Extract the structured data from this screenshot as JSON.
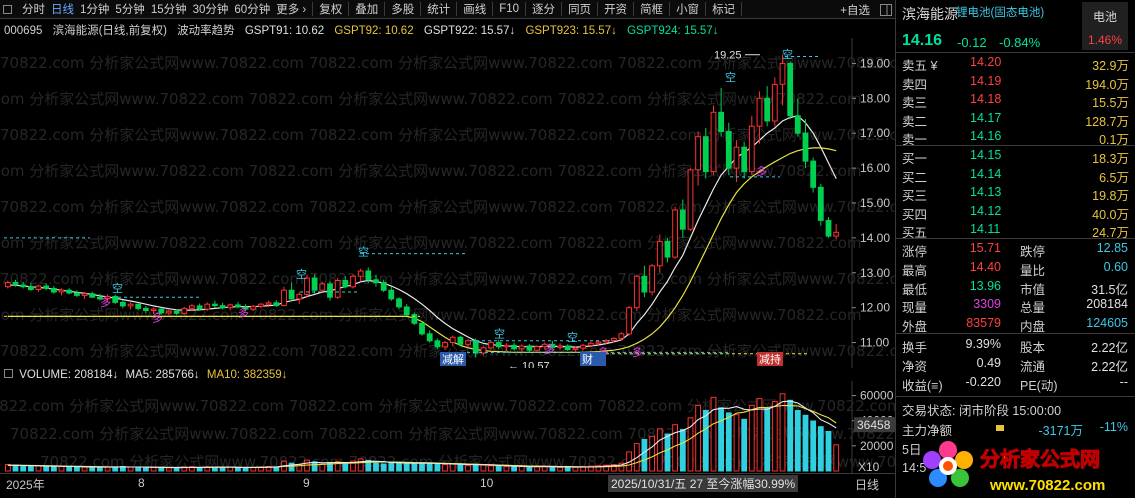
{
  "toolbar": {
    "items": [
      "分时",
      "日线",
      "1分钟",
      "5分钟",
      "15分钟",
      "30分钟",
      "60分钟",
      "更多 ›",
      "复权",
      "叠加",
      "多股",
      "统计",
      "画线",
      "F10",
      "逐分",
      "同页",
      "开资",
      "简框",
      "小窗",
      "标记"
    ],
    "add_label": "+自选",
    "active_index": 1
  },
  "indicator": {
    "code": "000695",
    "name": "滨海能源(日线,前复权)",
    "label": "波动率趋势",
    "g91": "GSPT91: 10.62",
    "g92": "GSPT92: 10.62",
    "g922": "GSPT922: 15.57↓",
    "g923": "GSPT923: 15.57↓",
    "g924": "GSPT924: 15.57↓"
  },
  "colors": {
    "up": "#ff3030",
    "down": "#00d050",
    "ma_white": "#e8e8e8",
    "ma_yellow": "#e8e040",
    "cyan": "#3cc8e6",
    "grid": "#262626"
  },
  "watermark": "70822.com 分析家公式网www.70822.com",
  "price_axis": {
    "ticks": [
      "19.00",
      "18.00",
      "17.00",
      "16.00",
      "15.00",
      "14.00",
      "13.00",
      "12.00",
      "11.00"
    ],
    "values": [
      19,
      18,
      17,
      16,
      15,
      14,
      13,
      12,
      11
    ],
    "min": 10.5,
    "max": 19.5
  },
  "annotations": {
    "high": "19.25",
    "low": "10.57",
    "kong": "空",
    "duo": "多",
    "jiebei": "减解",
    "cai": "财",
    "guaxia": "减持"
  },
  "volume": {
    "header_label": "VOLUME: 208184↓",
    "ma5_label": "MA5: 285766↓",
    "ma10_label": "MA10: 382359↓",
    "axis_ticks": [
      "60000",
      "40000",
      "20000"
    ],
    "axis_values": [
      60000,
      40000,
      20000
    ],
    "current_tag": "36458",
    "unit": "X10",
    "max": 70000
  },
  "date_axis": {
    "labels": [
      "2025年",
      "8",
      "9",
      "10",
      "日线"
    ],
    "status": "2025/10/31/五 27 至今涨幅30.99%"
  },
  "chart_data": {
    "type": "candlestick",
    "ohlc": [
      [
        12.6,
        12.78,
        12.55,
        12.72
      ],
      [
        12.72,
        12.8,
        12.6,
        12.65
      ],
      [
        12.65,
        12.74,
        12.55,
        12.6
      ],
      [
        12.6,
        12.7,
        12.48,
        12.52
      ],
      [
        12.52,
        12.66,
        12.45,
        12.62
      ],
      [
        12.62,
        12.7,
        12.5,
        12.55
      ],
      [
        12.55,
        12.62,
        12.4,
        12.45
      ],
      [
        12.45,
        12.55,
        12.35,
        12.5
      ],
      [
        12.5,
        12.56,
        12.38,
        12.42
      ],
      [
        12.42,
        12.5,
        12.3,
        12.35
      ],
      [
        12.35,
        12.45,
        12.25,
        12.4
      ],
      [
        12.4,
        12.46,
        12.28,
        12.3
      ],
      [
        12.3,
        12.4,
        12.2,
        12.25
      ],
      [
        12.25,
        12.38,
        12.15,
        12.32
      ],
      [
        12.32,
        12.38,
        12.1,
        12.15
      ],
      [
        12.15,
        12.22,
        11.98,
        12.05
      ],
      [
        12.05,
        12.15,
        11.95,
        12.1
      ],
      [
        12.1,
        12.12,
        11.92,
        11.98
      ],
      [
        11.98,
        12.05,
        11.85,
        11.92
      ],
      [
        11.92,
        12.0,
        11.82,
        11.96
      ],
      [
        11.96,
        12.0,
        11.8,
        11.85
      ],
      [
        11.85,
        11.95,
        11.78,
        11.9
      ],
      [
        11.9,
        11.96,
        11.8,
        11.84
      ],
      [
        11.84,
        12.02,
        11.8,
        11.98
      ],
      [
        11.98,
        12.1,
        11.9,
        12.05
      ],
      [
        12.05,
        12.12,
        11.92,
        11.96
      ],
      [
        11.96,
        12.15,
        11.9,
        12.1
      ],
      [
        12.1,
        12.2,
        12.0,
        12.06
      ],
      [
        12.06,
        12.14,
        11.95,
        12.0
      ],
      [
        12.0,
        12.12,
        11.92,
        12.08
      ],
      [
        12.08,
        12.16,
        11.98,
        12.02
      ],
      [
        12.02,
        12.1,
        11.9,
        11.96
      ],
      [
        11.96,
        12.08,
        11.9,
        12.04
      ],
      [
        12.04,
        12.14,
        11.98,
        12.1
      ],
      [
        12.1,
        12.2,
        12.02,
        12.14
      ],
      [
        12.14,
        12.22,
        12.02,
        12.06
      ],
      [
        12.06,
        12.6,
        12.04,
        12.5
      ],
      [
        12.5,
        12.72,
        12.2,
        12.25
      ],
      [
        12.25,
        12.45,
        12.1,
        12.38
      ],
      [
        12.38,
        12.95,
        12.3,
        12.85
      ],
      [
        12.85,
        12.95,
        12.4,
        12.5
      ],
      [
        12.5,
        12.74,
        12.45,
        12.68
      ],
      [
        12.68,
        12.75,
        12.2,
        12.3
      ],
      [
        12.3,
        12.85,
        12.25,
        12.78
      ],
      [
        12.78,
        12.9,
        12.55,
        12.6
      ],
      [
        12.6,
        12.95,
        12.55,
        12.9
      ],
      [
        12.9,
        13.12,
        12.75,
        13.05
      ],
      [
        13.05,
        13.15,
        12.7,
        12.8
      ],
      [
        12.8,
        12.95,
        12.6,
        12.72
      ],
      [
        12.72,
        12.8,
        12.45,
        12.5
      ],
      [
        12.5,
        12.6,
        12.2,
        12.25
      ],
      [
        12.25,
        12.3,
        11.95,
        12.02
      ],
      [
        12.02,
        12.1,
        11.75,
        11.8
      ],
      [
        11.8,
        11.86,
        11.5,
        11.55
      ],
      [
        11.55,
        11.6,
        11.2,
        11.25
      ],
      [
        11.25,
        11.35,
        11.0,
        11.05
      ],
      [
        11.05,
        11.12,
        10.8,
        10.88
      ],
      [
        10.88,
        11.05,
        10.8,
        11.0
      ],
      [
        11.0,
        11.2,
        10.9,
        11.15
      ],
      [
        11.15,
        11.2,
        10.9,
        10.95
      ],
      [
        10.95,
        11.1,
        10.85,
        11.05
      ],
      [
        11.05,
        11.12,
        10.57,
        10.7
      ],
      [
        10.7,
        10.9,
        10.62,
        10.85
      ],
      [
        10.85,
        11.05,
        10.8,
        11.0
      ],
      [
        11.0,
        11.08,
        10.82,
        10.88
      ],
      [
        10.88,
        10.98,
        10.76,
        10.92
      ],
      [
        10.92,
        11.0,
        10.78,
        10.82
      ],
      [
        10.82,
        10.95,
        10.75,
        10.9
      ],
      [
        10.9,
        10.96,
        10.72,
        10.78
      ],
      [
        10.78,
        10.92,
        10.72,
        10.88
      ],
      [
        10.88,
        11.0,
        10.8,
        10.95
      ],
      [
        10.95,
        11.05,
        10.82,
        10.86
      ],
      [
        10.86,
        10.98,
        10.78,
        10.9
      ],
      [
        10.9,
        10.95,
        10.76,
        10.8
      ],
      [
        10.8,
        10.88,
        10.7,
        10.84
      ],
      [
        10.84,
        10.96,
        10.78,
        10.92
      ],
      [
        10.92,
        11.02,
        10.86,
        10.98
      ],
      [
        10.98,
        11.06,
        10.9,
        11.02
      ],
      [
        11.02,
        11.1,
        10.94,
        11.06
      ],
      [
        11.06,
        11.15,
        11.0,
        11.12
      ],
      [
        11.12,
        11.3,
        11.05,
        11.25
      ],
      [
        11.25,
        12.05,
        11.2,
        12.0
      ],
      [
        12.0,
        12.95,
        11.9,
        12.9
      ],
      [
        12.9,
        13.2,
        12.3,
        12.45
      ],
      [
        12.45,
        13.25,
        12.35,
        13.2
      ],
      [
        13.2,
        14.1,
        13.0,
        13.9
      ],
      [
        13.9,
        14.0,
        13.3,
        13.45
      ],
      [
        13.45,
        14.9,
        13.4,
        14.8
      ],
      [
        14.8,
        15.1,
        14.0,
        14.25
      ],
      [
        14.25,
        16.0,
        14.2,
        15.95
      ],
      [
        15.95,
        17.05,
        15.5,
        16.9
      ],
      [
        16.9,
        17.15,
        15.7,
        15.9
      ],
      [
        15.9,
        17.8,
        15.8,
        17.6
      ],
      [
        17.6,
        18.3,
        16.9,
        17.05
      ],
      [
        17.05,
        17.3,
        15.8,
        16.0
      ],
      [
        16.0,
        16.8,
        15.6,
        16.6
      ],
      [
        16.6,
        16.75,
        15.7,
        15.9
      ],
      [
        15.9,
        17.5,
        15.8,
        17.2
      ],
      [
        17.2,
        18.2,
        16.7,
        18.0
      ],
      [
        18.0,
        18.35,
        17.2,
        17.35
      ],
      [
        17.35,
        18.6,
        17.2,
        18.4
      ],
      [
        18.4,
        19.25,
        17.8,
        19.0
      ],
      [
        19.0,
        19.05,
        17.4,
        17.5
      ],
      [
        17.5,
        18.0,
        16.9,
        17.0
      ],
      [
        17.0,
        17.4,
        16.0,
        16.2
      ],
      [
        16.2,
        16.3,
        15.3,
        15.45
      ],
      [
        15.45,
        15.55,
        14.35,
        14.5
      ],
      [
        14.5,
        14.6,
        14.0,
        14.05
      ],
      [
        14.05,
        14.4,
        13.96,
        14.16
      ]
    ],
    "volume": [
      5200,
      4800,
      4100,
      3900,
      4300,
      3700,
      3500,
      3800,
      3300,
      3100,
      3400,
      3000,
      2900,
      3200,
      3300,
      3600,
      3100,
      2800,
      3000,
      2700,
      2600,
      2500,
      2400,
      3200,
      3500,
      2900,
      3300,
      3000,
      2700,
      3100,
      2800,
      2600,
      2900,
      3200,
      3600,
      3300,
      7800,
      6200,
      5200,
      8600,
      7200,
      5400,
      6800,
      7500,
      6100,
      7900,
      9600,
      8400,
      6200,
      5600,
      6400,
      7100,
      6600,
      6100,
      6300,
      6400,
      5800,
      5100,
      5500,
      4800,
      4300,
      5200,
      4700,
      4100,
      3800,
      3500,
      3300,
      3600,
      3200,
      3400,
      3700,
      3100,
      2900,
      2800,
      3000,
      3400,
      3800,
      4200,
      4600,
      5100,
      6200,
      15200,
      21800,
      25100,
      27600,
      33500,
      29400,
      36800,
      33100,
      42300,
      52100,
      48200,
      58600,
      50300,
      46200,
      44800,
      41100,
      52300,
      57600,
      49800,
      55200,
      61400,
      56200,
      48100,
      44300,
      39800,
      35200,
      31400,
      20818
    ],
    "ma_white": [
      12.65,
      12.64,
      12.62,
      12.6,
      12.58,
      12.56,
      12.53,
      12.5,
      12.47,
      12.44,
      12.41,
      12.38,
      12.34,
      12.31,
      12.27,
      12.23,
      12.19,
      12.15,
      12.1,
      12.05,
      12.01,
      11.97,
      11.94,
      11.93,
      11.93,
      11.94,
      11.96,
      11.98,
      12.0,
      12.02,
      12.03,
      12.03,
      12.03,
      12.04,
      12.06,
      12.07,
      12.15,
      12.2,
      12.24,
      12.32,
      12.38,
      12.45,
      12.48,
      12.55,
      12.6,
      12.66,
      12.74,
      12.78,
      12.75,
      12.7,
      12.62,
      12.52,
      12.4,
      12.26,
      12.1,
      11.92,
      11.72,
      11.55,
      11.4,
      11.28,
      11.16,
      11.05,
      10.98,
      10.94,
      10.92,
      10.9,
      10.89,
      10.88,
      10.88,
      10.88,
      10.89,
      10.89,
      10.89,
      10.88,
      10.87,
      10.88,
      10.9,
      10.93,
      10.97,
      11.02,
      11.08,
      11.25,
      11.55,
      11.8,
      12.1,
      12.45,
      12.75,
      13.15,
      13.5,
      14.0,
      14.5,
      14.95,
      15.4,
      15.8,
      16.05,
      16.3,
      16.45,
      16.6,
      16.8,
      17.0,
      17.15,
      17.35,
      17.45,
      17.5,
      17.3,
      17.0,
      16.6,
      16.15,
      15.7
    ],
    "ma_yellow": [
      11.75,
      11.75,
      11.75,
      11.75,
      11.75,
      11.75,
      11.75,
      11.75,
      11.75,
      11.75,
      11.75,
      11.75,
      11.75,
      11.75,
      11.75,
      11.75,
      11.75,
      11.75,
      11.75,
      11.75,
      11.75,
      11.75,
      11.75,
      11.75,
      11.75,
      11.75,
      11.75,
      11.75,
      11.75,
      11.75,
      11.75,
      11.75,
      11.75,
      11.75,
      11.75,
      11.75,
      11.75,
      11.75,
      11.75,
      11.75,
      11.75,
      11.75,
      11.75,
      11.75,
      11.75,
      11.75,
      11.75,
      11.75,
      11.75,
      11.75,
      11.75,
      11.75,
      11.75,
      11.7,
      11.6,
      11.45,
      11.3,
      11.15,
      11.02,
      10.92,
      10.85,
      10.8,
      10.77,
      10.75,
      10.74,
      10.73,
      10.72,
      10.72,
      10.72,
      10.72,
      10.72,
      10.72,
      10.72,
      10.72,
      10.72,
      10.72,
      10.73,
      10.74,
      10.76,
      10.78,
      10.82,
      10.88,
      10.98,
      11.1,
      11.25,
      11.45,
      11.7,
      12.0,
      12.35,
      12.75,
      13.2,
      13.65,
      14.1,
      14.55,
      14.95,
      15.3,
      15.55,
      15.75,
      15.9,
      16.05,
      16.18,
      16.3,
      16.42,
      16.5,
      16.55,
      16.58,
      16.58,
      16.55,
      16.5
    ],
    "vol_ma5": [
      4500,
      4500,
      4400,
      4200,
      4100,
      3900,
      3800,
      3700,
      3600,
      3500,
      3300,
      3200,
      3100,
      3100,
      3100,
      3200,
      3200,
      3200,
      3100,
      3000,
      2900,
      2800,
      2700,
      2700,
      2800,
      2900,
      3000,
      3100,
      3100,
      3100,
      2900,
      2800,
      2800,
      2900,
      3000,
      3100,
      4100,
      4700,
      5300,
      6300,
      6900,
      6500,
      6600,
      6800,
      6800,
      6800,
      7400,
      7700,
      7700,
      7500,
      6800,
      6500,
      6300,
      6200,
      6300,
      6200,
      6000,
      5800,
      5600,
      5400,
      5100,
      5100,
      4900,
      4700,
      4400,
      4200,
      3900,
      3700,
      3500,
      3400,
      3400,
      3400,
      3300,
      3200,
      3100,
      3100,
      3200,
      3400,
      3800,
      4200,
      4800,
      7000,
      10600,
      15000,
      19200,
      24600,
      27500,
      30500,
      32100,
      35100,
      40900,
      43900,
      48800,
      49900,
      49900,
      51200,
      49100,
      48500,
      49300,
      49100,
      51400,
      55100,
      55600,
      54100,
      50000,
      46400,
      40800,
      38000,
      34300
    ],
    "vol_ma10": [
      4600,
      4600,
      4550,
      4450,
      4350,
      4250,
      4100,
      4000,
      3850,
      3750,
      3650,
      3550,
      3450,
      3350,
      3300,
      3250,
      3200,
      3150,
      3100,
      3050,
      3000,
      2950,
      2900,
      2900,
      2900,
      2900,
      2900,
      2950,
      2950,
      3000,
      3000,
      2950,
      2950,
      3000,
      3050,
      3100,
      3600,
      3900,
      4200,
      4700,
      5000,
      5300,
      5600,
      5900,
      6200,
      6300,
      6600,
      6900,
      7100,
      7200,
      7100,
      7000,
      6900,
      6700,
      6600,
      6500,
      6300,
      6100,
      6000,
      5800,
      5600,
      5400,
      5200,
      5000,
      4800,
      4600,
      4400,
      4200,
      4000,
      3900,
      3800,
      3700,
      3600,
      3500,
      3400,
      3350,
      3300,
      3350,
      3450,
      3600,
      3900,
      4800,
      6700,
      8800,
      11200,
      14400,
      16800,
      19900,
      22300,
      25700,
      30100,
      33600,
      37600,
      40000,
      42700,
      46000,
      46800,
      48800,
      50600,
      50500,
      51300,
      52100,
      52000,
      51800,
      49600,
      47400,
      44700,
      42400,
      38200
    ]
  },
  "panel": {
    "title": "滨海能源",
    "sector": "锂电池(固态电池)",
    "sector_box_name": "电池",
    "sector_box_value": "1.46%",
    "price": "14.16",
    "change": "-0.12",
    "change_pct": "-0.84%",
    "asks": [
      {
        "label": "卖五 ¥",
        "price": "14.20",
        "vol": "32.9万",
        "pcolor": "red"
      },
      {
        "label": "卖四",
        "price": "14.19",
        "vol": "194.0万",
        "pcolor": "red"
      },
      {
        "label": "卖三",
        "price": "14.18",
        "vol": "15.5万",
        "pcolor": "red"
      },
      {
        "label": "卖二",
        "price": "14.17",
        "vol": "128.7万",
        "pcolor": "green"
      },
      {
        "label": "卖一",
        "price": "14.16",
        "vol": "0.1万",
        "pcolor": "green"
      }
    ],
    "bids": [
      {
        "label": "买一",
        "price": "14.15",
        "vol": "18.3万",
        "pcolor": "green"
      },
      {
        "label": "买二",
        "price": "14.14",
        "vol": "6.5万",
        "pcolor": "green"
      },
      {
        "label": "买三",
        "price": "14.13",
        "vol": "19.8万",
        "pcolor": "green"
      },
      {
        "label": "买四",
        "price": "14.12",
        "vol": "40.0万",
        "pcolor": "green"
      },
      {
        "label": "买五",
        "price": "14.11",
        "vol": "24.7万",
        "pcolor": "green"
      }
    ],
    "stats1": [
      {
        "l1": "涨停",
        "v1": "15.71",
        "c1": "red",
        "l2": "跌停",
        "v2": "12.85",
        "c2": "cyan"
      },
      {
        "l1": "最高",
        "v1": "14.40",
        "c1": "red",
        "l2": "量比",
        "v2": "0.60",
        "c2": "cyan"
      },
      {
        "l1": "最低",
        "v1": "13.96",
        "c1": "green",
        "l2": "市值",
        "v2": "31.5亿",
        "c2": "white"
      },
      {
        "l1": "现量",
        "v1": "3309",
        "c1": "mag",
        "l2": "总量",
        "v2": "208184",
        "c2": "white"
      },
      {
        "l1": "外盘",
        "v1": "83579",
        "c1": "red",
        "l2": "内盘",
        "v2": "124605",
        "c2": "cyan"
      }
    ],
    "stats2": [
      {
        "l1": "换手",
        "v1": "9.39%",
        "c1": "white",
        "l2": "股本",
        "v2": "2.22亿",
        "c2": "white"
      },
      {
        "l1": "净资",
        "v1": "0.49",
        "c1": "white",
        "l2": "流通",
        "v2": "2.22亿",
        "c2": "white"
      },
      {
        "l1": "收益(≡)",
        "v1": "-0.220",
        "c1": "white",
        "l2": "PE(动)",
        "v2": "--",
        "c2": "white"
      }
    ],
    "trade_status": "交易状态: 闭市阶段 15:00:00",
    "main_net_label": "主力净额",
    "main_net_value": "-3171万",
    "main_net_pct": "-11%",
    "row5_label": "5日",
    "row6_label": "14:5"
  },
  "logo_text": "分析家公式网",
  "logo_url": "www.70822.com"
}
